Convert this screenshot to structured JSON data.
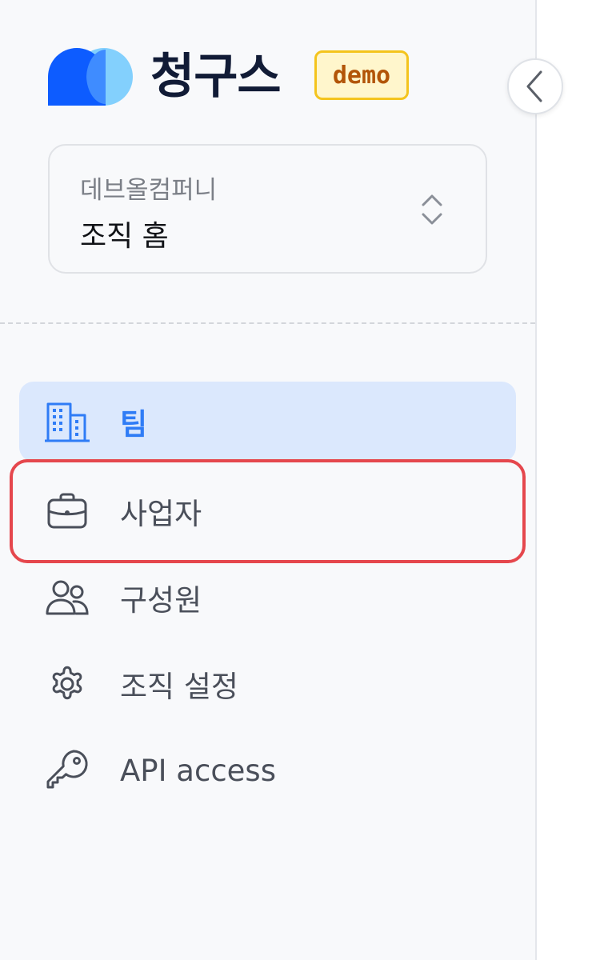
{
  "brand": {
    "name": "청구스",
    "badge": "demo",
    "colors": {
      "primary": "#0d5cff",
      "secondary": "#83d0fd",
      "text": "#111b36"
    }
  },
  "org_selector": {
    "org_name": "데브올컴퍼니",
    "current_page": "조직 홈",
    "icon": "chevron-up-down-icon"
  },
  "nav": {
    "items": [
      {
        "label": "팀",
        "icon": "building-icon",
        "active": true
      },
      {
        "label": "사업자",
        "icon": "briefcase-icon",
        "active": false,
        "highlighted": true
      },
      {
        "label": "구성원",
        "icon": "users-icon",
        "active": false
      },
      {
        "label": "조직 설정",
        "icon": "gear-icon",
        "active": false
      },
      {
        "label": "API access",
        "icon": "key-icon",
        "active": false
      }
    ]
  },
  "colors": {
    "active_bg": "#dbe8fd",
    "active_text": "#2f7cf6",
    "highlight_border": "#e5474d",
    "sidebar_bg": "#f8f9fb"
  }
}
